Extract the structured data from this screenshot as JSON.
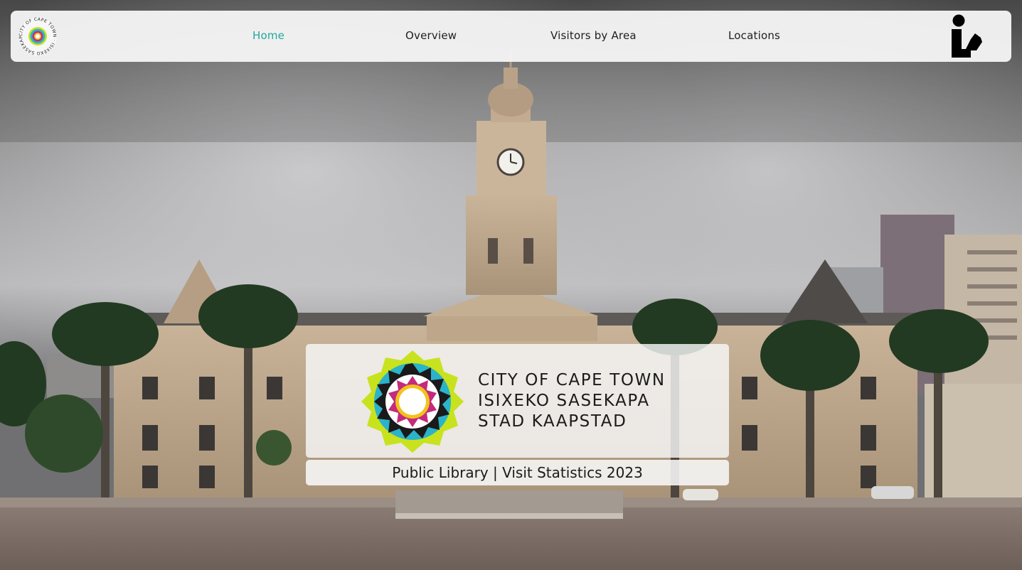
{
  "nav": {
    "logo_ring_text": "CITY OF CAPE TOWN · ISIXEKO SASEKAPA · STAD KAAPSTAD ·",
    "items": [
      {
        "label": "Home",
        "active": true
      },
      {
        "label": "Overview",
        "active": false
      },
      {
        "label": "Visitors by Area",
        "active": false
      },
      {
        "label": "Locations",
        "active": false
      }
    ],
    "right_icon": "library-reader-icon"
  },
  "hero": {
    "brand_lines": [
      "CITY OF CAPE TOWN",
      "ISIXEKO SASEKAPA",
      "STAD KAAPSTAD"
    ],
    "caption": "Public Library | Visit Statistics 2023"
  },
  "colors": {
    "active_nav": "#20a89a",
    "emblem_green": "#c8e21d",
    "emblem_cyan": "#2bb3c9",
    "emblem_magenta": "#c42a7d",
    "emblem_yellow": "#f3c21a"
  }
}
